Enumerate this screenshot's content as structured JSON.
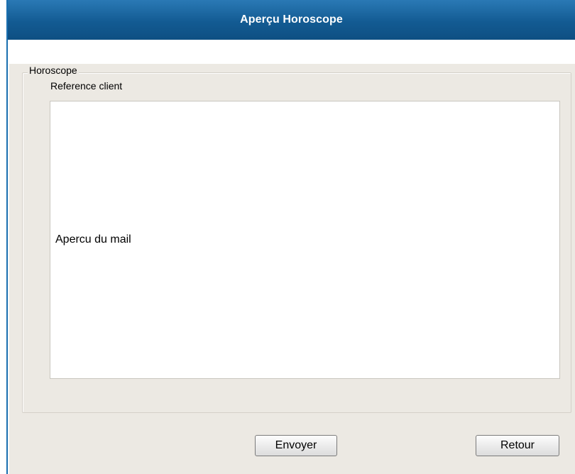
{
  "window": {
    "title": "Aperçu Horoscope"
  },
  "horoscope": {
    "legend": "Horoscope",
    "reference_label": "Reference client",
    "mail_preview_text": "Apercu du mail"
  },
  "buttons": {
    "send_label": "Envoyer",
    "back_label": "Retour"
  },
  "colors": {
    "titlebar": "#135b93",
    "panel_background": "#ece9e3",
    "accent_border": "#1a6fb0"
  }
}
